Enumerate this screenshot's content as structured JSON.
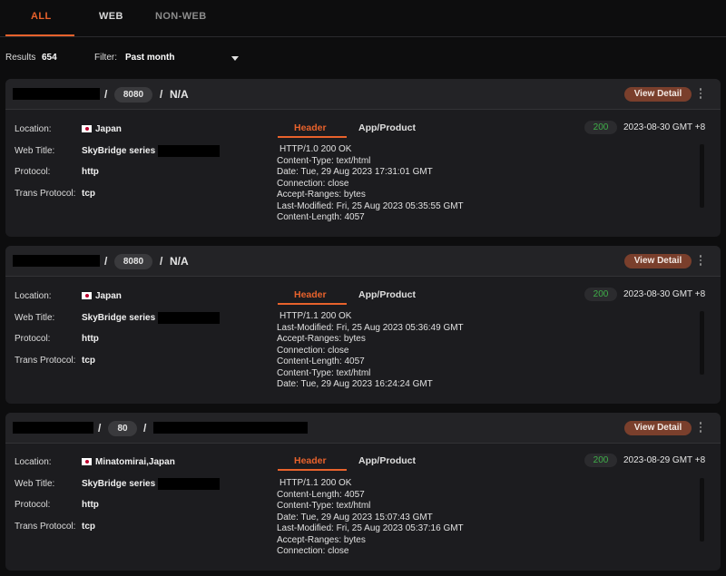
{
  "tabs": [
    {
      "label": "ALL"
    },
    {
      "label": "WEB"
    },
    {
      "label": "NON-WEB"
    }
  ],
  "filterbar": {
    "results_label": "Results",
    "results_count": "654",
    "filter_label": "Filter:",
    "filter_value": "Past month"
  },
  "colors": {
    "accent": "#e8622c",
    "status_ok": "#3fae49",
    "view_button": "#7a3f2c"
  },
  "cards": [
    {
      "port": "8080",
      "path": "N/A",
      "view_label": "View Detail",
      "labels": {
        "location": "Location:",
        "web_title": "Web Title:",
        "protocol": "Protocol:",
        "trans_protocol": "Trans Protocol:"
      },
      "location": "Japan",
      "web_title": "SkyBridge series -",
      "protocol": "http",
      "trans_protocol": "tcp",
      "header_tab": "Header",
      "app_tab": "App/Product",
      "status": "200",
      "date": "2023-08-30 GMT +8",
      "headers": [
        "HTTP/1.0 200 OK",
        "Content-Type: text/html",
        "Date: Tue, 29 Aug 2023 17:31:01 GMT",
        "Connection: close",
        "Accept-Ranges: bytes",
        "Last-Modified: Fri, 25 Aug 2023 05:35:55 GMT",
        "Content-Length: 4057"
      ]
    },
    {
      "port": "8080",
      "path": "N/A",
      "view_label": "View Detail",
      "labels": {
        "location": "Location:",
        "web_title": "Web Title:",
        "protocol": "Protocol:",
        "trans_protocol": "Trans Protocol:"
      },
      "location": "Japan",
      "web_title": "SkyBridge series -",
      "protocol": "http",
      "trans_protocol": "tcp",
      "header_tab": "Header",
      "app_tab": "App/Product",
      "status": "200",
      "date": "2023-08-30 GMT +8",
      "headers": [
        "HTTP/1.1 200 OK",
        "Last-Modified: Fri, 25 Aug 2023 05:36:49 GMT",
        "Accept-Ranges: bytes",
        "Connection: close",
        "Content-Length: 4057",
        "Content-Type: text/html",
        "Date: Tue, 29 Aug 2023 16:24:24 GMT"
      ]
    },
    {
      "port": "80",
      "path": "",
      "view_label": "View Detail",
      "labels": {
        "location": "Location:",
        "web_title": "Web Title:",
        "protocol": "Protocol:",
        "trans_protocol": "Trans Protocol:"
      },
      "location": "Minatomirai,Japan",
      "web_title": "SkyBridge series -",
      "protocol": "http",
      "trans_protocol": "tcp",
      "header_tab": "Header",
      "app_tab": "App/Product",
      "status": "200",
      "date": "2023-08-29 GMT +8",
      "headers": [
        "HTTP/1.1 200 OK",
        "Content-Length: 4057",
        "Content-Type: text/html",
        "Date: Tue, 29 Aug 2023 15:07:43 GMT",
        "Last-Modified: Fri, 25 Aug 2023 05:37:16 GMT",
        "Accept-Ranges: bytes",
        "Connection: close"
      ]
    }
  ]
}
